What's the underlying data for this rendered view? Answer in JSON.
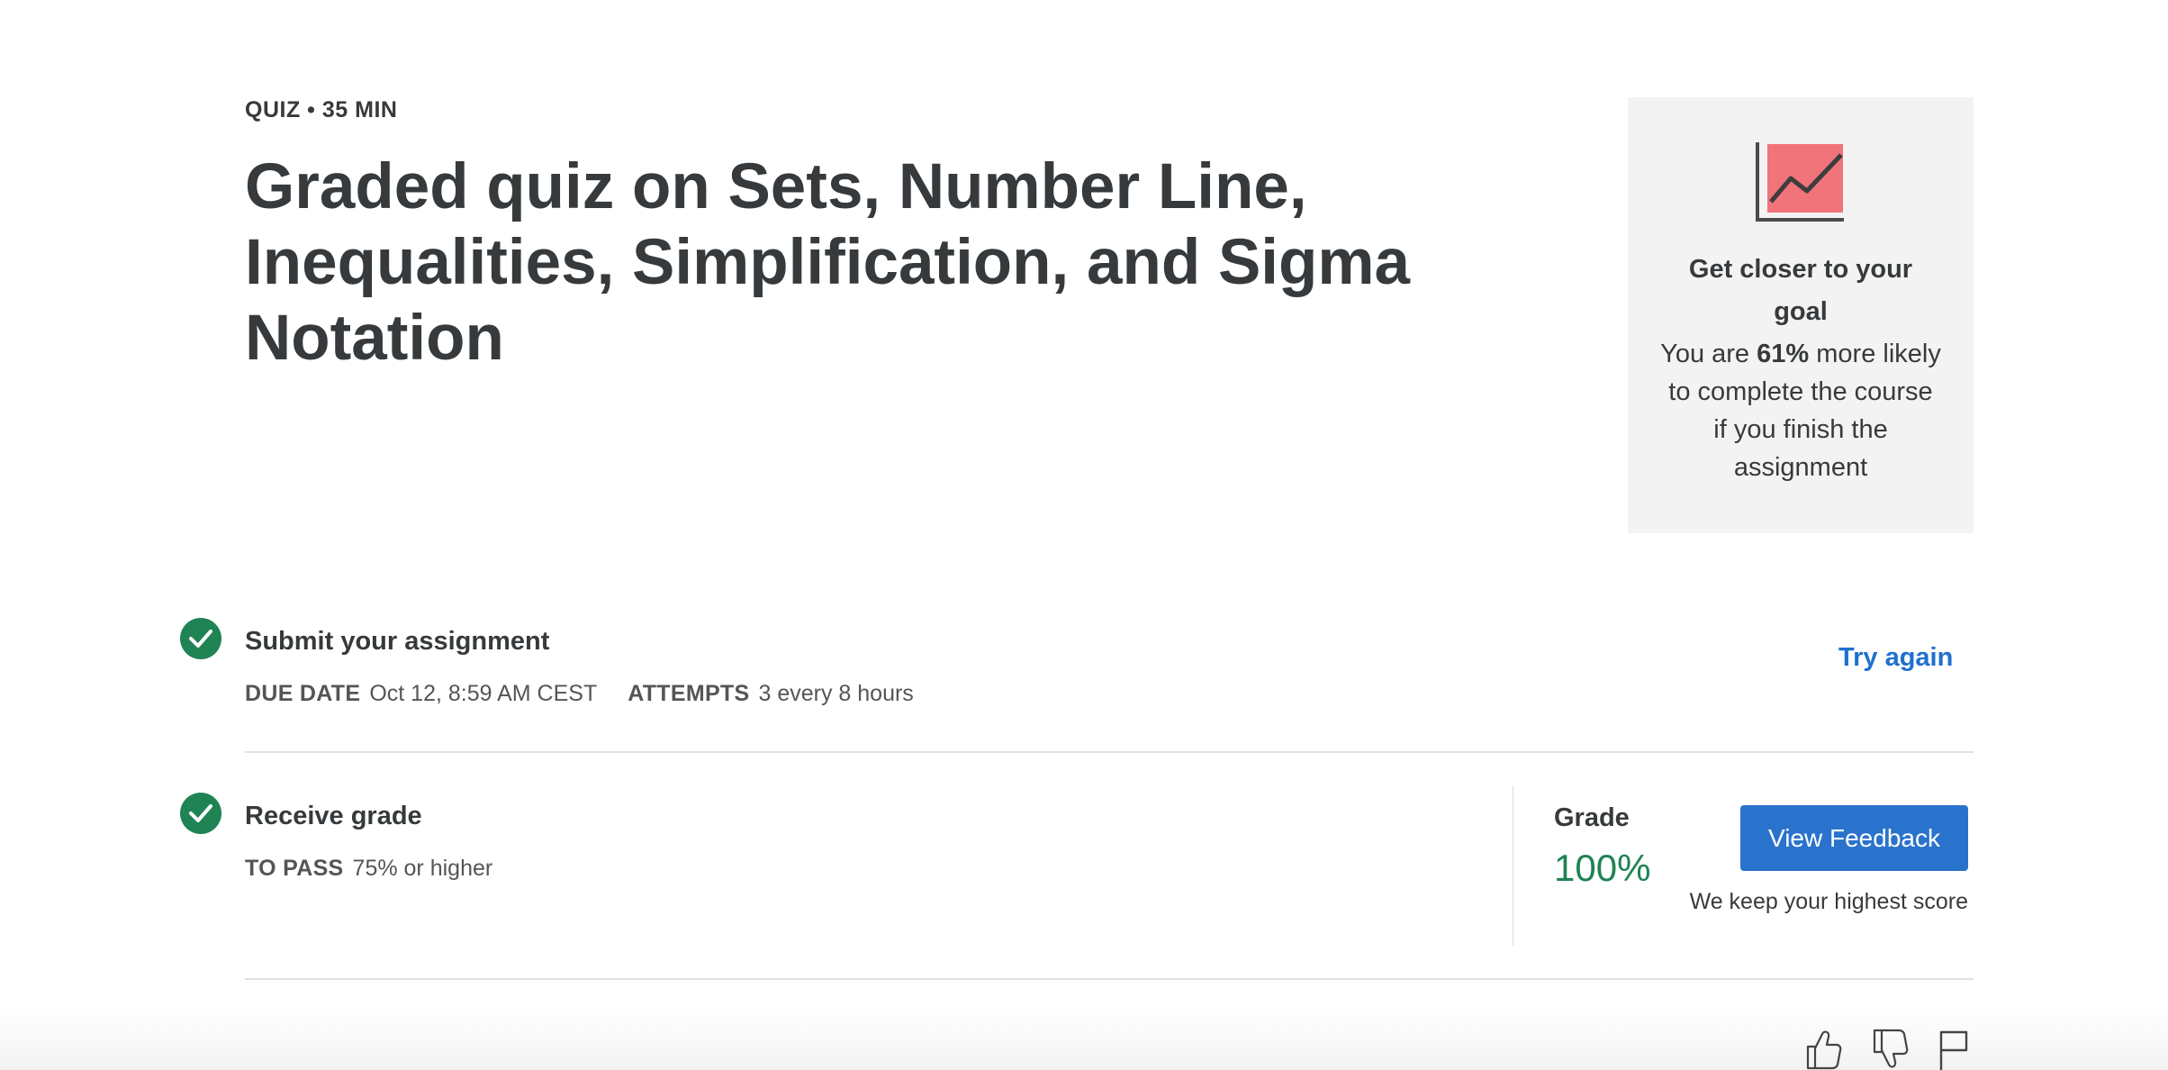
{
  "header": {
    "meta": "QUIZ • 35 MIN",
    "title": "Graded quiz on Sets, Number Line, Inequalities, Simplification, and Sigma Notation"
  },
  "goal_card": {
    "icon": "chart-icon",
    "heading": "Get closer to your goal",
    "text_before": "You are",
    "percent": "61%",
    "text_after": "more likely to complete the course if you finish the assignment"
  },
  "submit": {
    "title": "Submit your assignment",
    "due_label": "DUE DATE",
    "due_value": "Oct 12, 8:59 AM CEST",
    "attempts_label": "ATTEMPTS",
    "attempts_value": "3 every 8 hours",
    "action": "Try again"
  },
  "grade_row": {
    "title": "Receive grade",
    "pass_label": "TO PASS",
    "pass_value": "75% or higher",
    "grade_label": "Grade",
    "grade_value": "100%",
    "button": "View Feedback",
    "note": "We keep your highest score"
  },
  "colors": {
    "accent": "#2a73cc",
    "success": "#1f8354",
    "chart_fill": "#f2747b",
    "card_bg": "#f3f3f3"
  },
  "footer_icons": [
    "thumbs-up-icon",
    "thumbs-down-icon",
    "flag-icon"
  ]
}
